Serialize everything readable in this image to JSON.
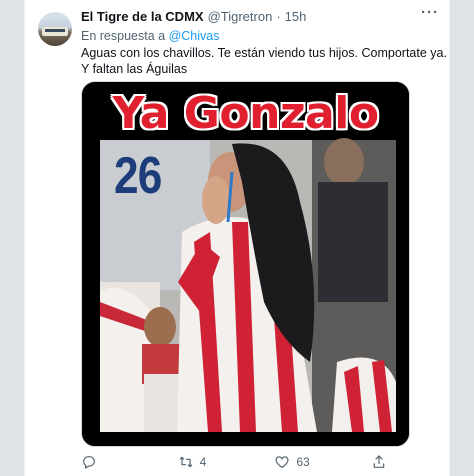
{
  "tweet": {
    "author_name": "El Tigre de la CDMX",
    "author_handle": "@Tigretron",
    "separator": "·",
    "time": "15h",
    "reply_prefix": "En respuesta a",
    "reply_mention": "@Chivas",
    "text_line1": "Aguas con los chavillos. Te están viendo tus hijos. Comportate ya.",
    "text_line2": "Y faltan las Águilas",
    "more_icon": "···"
  },
  "media": {
    "caption": "Ya Gonzalo",
    "jersey_number": "26"
  },
  "actions": {
    "reply_count": "",
    "retweet_count": "4",
    "like_count": "63",
    "share_count": ""
  },
  "colors": {
    "link": "#1d9bf0",
    "secondary_text": "#536471",
    "meme_red": "#e0202f"
  }
}
